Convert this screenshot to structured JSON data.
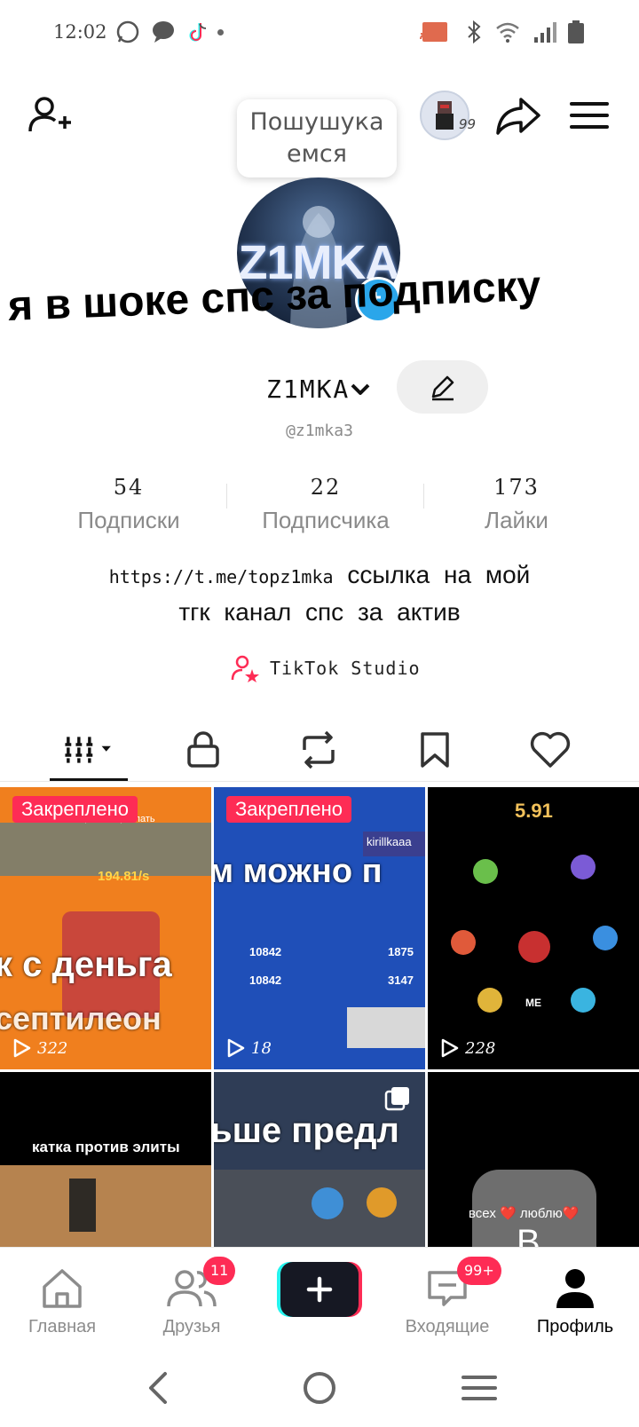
{
  "status_bar": {
    "time": "12:02"
  },
  "header": {
    "tooltip": "Пошушука емся",
    "story_count": "99"
  },
  "profile": {
    "avatar_text": "Z1MKA",
    "overlay_caption": "я в шоке спс за подписку",
    "display_name": "Z1MKA",
    "handle": "@z1mka3",
    "stats": [
      {
        "value": "54",
        "label": "Подписки"
      },
      {
        "value": "22",
        "label": "Подписчика"
      },
      {
        "value": "173",
        "label": "Лайки"
      }
    ],
    "bio_link": "https://t.me/topz1mka",
    "bio_line1": "ссылка на мой",
    "bio_line2": "тгк канал спс за актив",
    "studio_label": "TikTok Studio"
  },
  "videos": [
    {
      "pinned": "Закреплено",
      "views": "322",
      "caption": "к с деньга",
      "caption2": "септилеон",
      "top_text": "Копать, копать, копать",
      "stat_text": "194.81/s"
    },
    {
      "pinned": "Закреплено",
      "views": "18",
      "caption": "м можно п",
      "top_text": "kirillkaaa",
      "stat_a": "10842",
      "stat_b": "10842",
      "stat_c": "1875",
      "stat_d": "3147"
    },
    {
      "views": "228",
      "top_text": "5.91",
      "label": "ME"
    },
    {
      "caption": "катка против элиты"
    },
    {
      "caption": "ьше предл"
    },
    {
      "caption": "всех ❤️ люблю❤️",
      "caption2": "B"
    }
  ],
  "bottom_nav": {
    "home": "Главная",
    "friends": "Друзья",
    "friends_badge": "11",
    "inbox": "Входящие",
    "inbox_badge": "99+",
    "profile": "Профиль"
  },
  "colors": {
    "accent": "#fe2c55",
    "cyan": "#25f4ee"
  }
}
